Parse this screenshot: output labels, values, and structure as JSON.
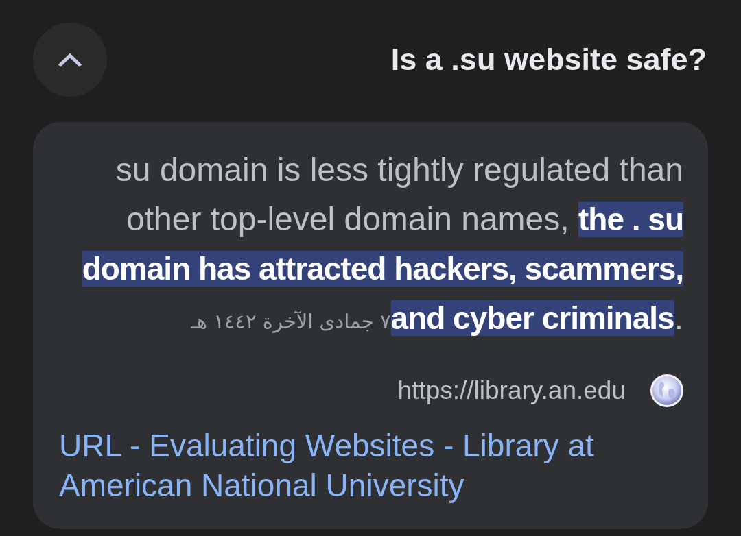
{
  "header": {
    "collapse_button": {
      "expanded": true
    },
    "question": "Is a .su website safe?"
  },
  "answer": {
    "snippet": "su domain is less tightly regulated than other top-level domain names, **the . su domain has attracted hackers, scammers, and cyber criminals**.",
    "date": "٧ جمادى الآخرة ١٤٤٢ هـ",
    "source_url": "https://library.an.edu",
    "title": "URL - Evaluating Websites - Library at American National University"
  }
}
